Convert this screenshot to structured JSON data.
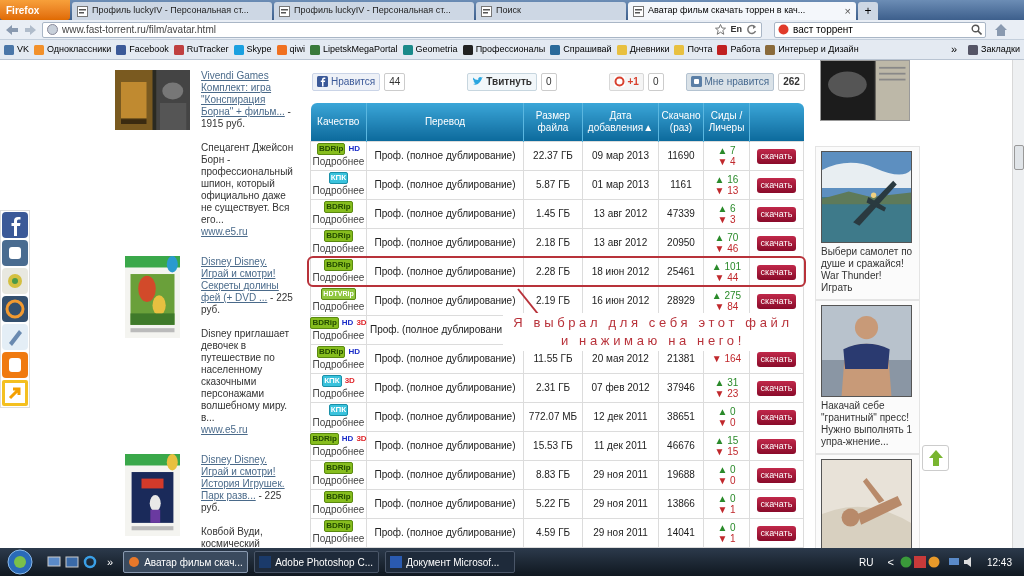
{
  "browser": {
    "menu_button": "Firefox",
    "tabs": [
      {
        "title": "Профиль luckyIV - Персональная ст...",
        "selected": false
      },
      {
        "title": "Профиль luckyIV - Персональная ст...",
        "selected": false
      },
      {
        "title": "Поиск",
        "selected": false
      },
      {
        "title": "Аватар фильм скачать торрен в кач...",
        "selected": true
      }
    ],
    "new_tab": "+",
    "close_tab": "×",
    "address": "www.fast-torrent.ru/film/avatar.html",
    "language": "En",
    "search": "васт торрент",
    "bookmarks": [
      "VK",
      "Одноклассники",
      "Facebook",
      "RuTracker",
      "Skype",
      "qiwi",
      "LipetskMegaPortal",
      "Geometria",
      "Профессионалы",
      "Спрашивай",
      "Дневники",
      "Почта",
      "Работа",
      "Интерьер и Дизайн"
    ],
    "more_bookmarks": "»",
    "bookmarks_menu": "Закладки"
  },
  "share": [
    {
      "kind": "facebook",
      "label": "Нравится",
      "count": "44"
    },
    {
      "kind": "twitter",
      "label": "Твитнуть",
      "count": "0"
    },
    {
      "kind": "gplus",
      "label": "+1",
      "count": "0"
    },
    {
      "kind": "vk",
      "label": "Мне нравится",
      "count": "262"
    }
  ],
  "left_ads": [
    {
      "title": "Vivendi Games Комплект: игра \"Конспирация Борна\" + фильм...",
      "price": "- 1915 руб.",
      "description": "Спецагент Джейсон Борн - профессиональный шпион, который официально даже не существует. Вся его...",
      "link": "www.e5.ru"
    },
    {
      "title": "Disney Disney. Играй и смотри! Секреты долины фей (+ DVD ...",
      "price": "- 225 руб.",
      "description": "Disney приглашает девочек в путешествие по населенному сказочными персонажами волшебному миру. в...",
      "link": "www.e5.ru"
    },
    {
      "title": "Disney Disney. Играй и смотри! История Игрушек. Парк разв...",
      "price": "- 225 руб.",
      "description": "Ковбой Вуди, космический"
    }
  ],
  "table": {
    "columns": [
      "Качество",
      "Перевод",
      "Размер файла",
      "Дата добавления▲",
      "Скачано (раз)",
      "Сиды / Личеры"
    ],
    "rows": [
      {
        "badges": [
          {
            "kind": "bdrip",
            "text": "BDRip"
          },
          {
            "kind": "hd",
            "text": "HD"
          }
        ],
        "details": "Подробнее",
        "translation": "Проф. (полное дублирование)",
        "size": "22.37 ГБ",
        "date": "09 мар 2013",
        "downloads": "11690",
        "seeders": "▲ 7",
        "leechers": "▼ 4",
        "button": "скачать",
        "circled": false
      },
      {
        "badges": [
          {
            "kind": "kpk",
            "text": "КПК"
          }
        ],
        "details": "Подробнее",
        "translation": "Проф. (полное дублирование)",
        "size": "5.87 ГБ",
        "date": "01 мар 2013",
        "downloads": "1161",
        "seeders": "▲ 16",
        "leechers": "▼ 13",
        "button": "скачать",
        "circled": false
      },
      {
        "badges": [
          {
            "kind": "bdrip",
            "text": "BDRip"
          }
        ],
        "details": "Подробнее",
        "translation": "Проф. (полное дублирование)",
        "size": "1.45 ГБ",
        "date": "13 авг 2012",
        "downloads": "47339",
        "seeders": "▲ 6",
        "leechers": "▼ 3",
        "button": "скачать",
        "circled": false
      },
      {
        "badges": [
          {
            "kind": "bdrip",
            "text": "BDRip"
          }
        ],
        "details": "Подробнее",
        "translation": "Проф. (полное дублирование)",
        "size": "2.18 ГБ",
        "date": "13 авг 2012",
        "downloads": "20950",
        "seeders": "▲ 70",
        "leechers": "▼ 46",
        "button": "скачать",
        "circled": false
      },
      {
        "badges": [
          {
            "kind": "bdrip",
            "text": "BDRip"
          }
        ],
        "details": "Подробнее",
        "translation": "Проф. (полное дублирование)",
        "size": "2.28 ГБ",
        "date": "18 июн 2012",
        "downloads": "25461",
        "seeders": "▲ 101",
        "leechers": "▼ 44",
        "button": "скачать",
        "circled": true
      },
      {
        "badges": [
          {
            "kind": "hdtvrip",
            "text": "HDTVRip"
          }
        ],
        "details": "Подробнее",
        "translation": "Проф. (полное дублирование)",
        "size": "2.19 ГБ",
        "date": "16 июн 2012",
        "downloads": "28929",
        "seeders": "▲ 275",
        "leechers": "▼ 84",
        "button": "скачать",
        "circled": false
      },
      {
        "badges": [
          {
            "kind": "bdrip",
            "text": "BDRip"
          },
          {
            "kind": "hd",
            "text": "HD"
          },
          {
            "kind": "stereo",
            "text": "3D"
          }
        ],
        "details": "Подробнее",
        "translation": "Проф. (полное дублировани",
        "circled": false
      },
      {
        "badges": [
          {
            "kind": "bdrip",
            "text": "BDRip"
          },
          {
            "kind": "hd",
            "text": "HD"
          }
        ],
        "details": "Подробнее",
        "translation": "Проф. (полное дублирование)",
        "size": "11.55 ГБ",
        "date": "20 мая 2012",
        "downloads": "21381",
        "leechers": "▼ 164",
        "button": "скачать",
        "circled": false
      },
      {
        "badges": [
          {
            "kind": "kpk",
            "text": "КПК"
          },
          {
            "kind": "stereo",
            "text": "3D"
          }
        ],
        "details": "Подробнее",
        "translation": "Проф. (полное дублирование)",
        "size": "2.31 ГБ",
        "date": "07 фев 2012",
        "downloads": "37946",
        "seeders": "▲ 31",
        "leechers": "▼ 23",
        "button": "скачать",
        "circled": false
      },
      {
        "badges": [
          {
            "kind": "kpk",
            "text": "КПК"
          }
        ],
        "details": "Подробнее",
        "translation": "Проф. (полное дублирование)",
        "size": "772.07 МБ",
        "date": "12 дек 2011",
        "downloads": "38651",
        "seeders": "▲ 0",
        "leechers": "▼ 0",
        "button": "скачать",
        "circled": false
      },
      {
        "badges": [
          {
            "kind": "bdrip",
            "text": "BDRip"
          },
          {
            "kind": "hd",
            "text": "HD"
          },
          {
            "kind": "stereo",
            "text": "3D"
          }
        ],
        "details": "Подробнее",
        "translation": "Проф. (полное дублирование)",
        "size": "15.53 ГБ",
        "date": "11 дек 2011",
        "downloads": "46676",
        "seeders": "▲ 15",
        "leechers": "▼ 15",
        "button": "скачать",
        "circled": false
      },
      {
        "badges": [
          {
            "kind": "bdrip",
            "text": "BDRip"
          }
        ],
        "details": "Подробнее",
        "translation": "Проф. (полное дублирование)",
        "size": "8.83 ГБ",
        "date": "29 ноя 2011",
        "downloads": "19688",
        "seeders": "▲ 0",
        "leechers": "▼ 0",
        "button": "скачать",
        "circled": false
      },
      {
        "badges": [
          {
            "kind": "bdrip",
            "text": "BDRip"
          }
        ],
        "details": "Подробнее",
        "translation": "Проф. (полное дублирование)",
        "size": "5.22 ГБ",
        "date": "29 ноя 2011",
        "downloads": "13866",
        "seeders": "▲ 0",
        "leechers": "▼ 1",
        "button": "скачать",
        "circled": false
      },
      {
        "badges": [
          {
            "kind": "bdrip",
            "text": "BDRip"
          }
        ],
        "details": "Подробнее",
        "translation": "Проф. (полное дублирование)",
        "size": "4.59 ГБ",
        "date": "29 ноя 2011",
        "downloads": "14041",
        "seeders": "▲ 0",
        "leechers": "▼ 1",
        "button": "скачать",
        "circled": false
      }
    ]
  },
  "annotation": "Я выбрал для себя этот файл\nи нажимаю на него!",
  "right_ads": [
    {
      "kind": "picture"
    },
    {
      "kind": "picture",
      "text": "Выбери самолет по душе и сражайся! War Thunder! Играть"
    },
    {
      "kind": "picture",
      "text": "Накачай себе \"гранитный\" пресс! Нужно выполнять 1 упра-жнение..."
    },
    {
      "kind": "picture"
    }
  ],
  "taskbar": {
    "more": "»",
    "tasks": [
      {
        "title": "Аватар фильм скач...",
        "selected": true
      },
      {
        "title": "Adobe Photoshop C...",
        "selected": false
      },
      {
        "title": "Документ Microsof...",
        "selected": false
      }
    ],
    "language": "RU",
    "tray_toggle": "<",
    "time": "12:43"
  }
}
